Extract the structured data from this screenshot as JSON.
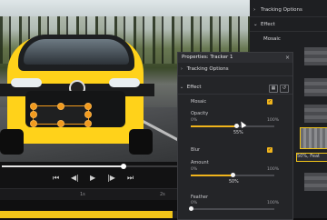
{
  "video": {
    "timeline_ticks": [
      "1s",
      "2s"
    ]
  },
  "transport": {
    "icons": [
      "skip-start-icon",
      "step-back-icon",
      "play-icon",
      "step-forward-icon",
      "skip-end-icon"
    ],
    "playback_progress": 0.67
  },
  "background_panel": {
    "tracking_options": "Tracking Options",
    "effect": "Effect",
    "mosaic": "Mosaic",
    "thumb_label": "50%, Feat"
  },
  "properties": {
    "title": "Properties: Tracker 1",
    "close": "×",
    "tracking_options": "Tracking Options",
    "effect_section": "Effect",
    "mosaic": {
      "label": "Mosaic",
      "enabled": true,
      "opacity_label": "Opacity",
      "min": "0%",
      "max": "100%",
      "value_text": "55%",
      "value": 0.55
    },
    "blur": {
      "label": "Blur",
      "enabled": true,
      "amount_label": "Amount",
      "min": "0%",
      "max": "100%",
      "value_text": "50%",
      "value": 0.5
    },
    "feather": {
      "label": "Feather",
      "min": "0%",
      "max": "100%"
    }
  },
  "colors": {
    "accent": "#f0b41c",
    "tracker": "#f29a1c",
    "panel": "#242528"
  }
}
